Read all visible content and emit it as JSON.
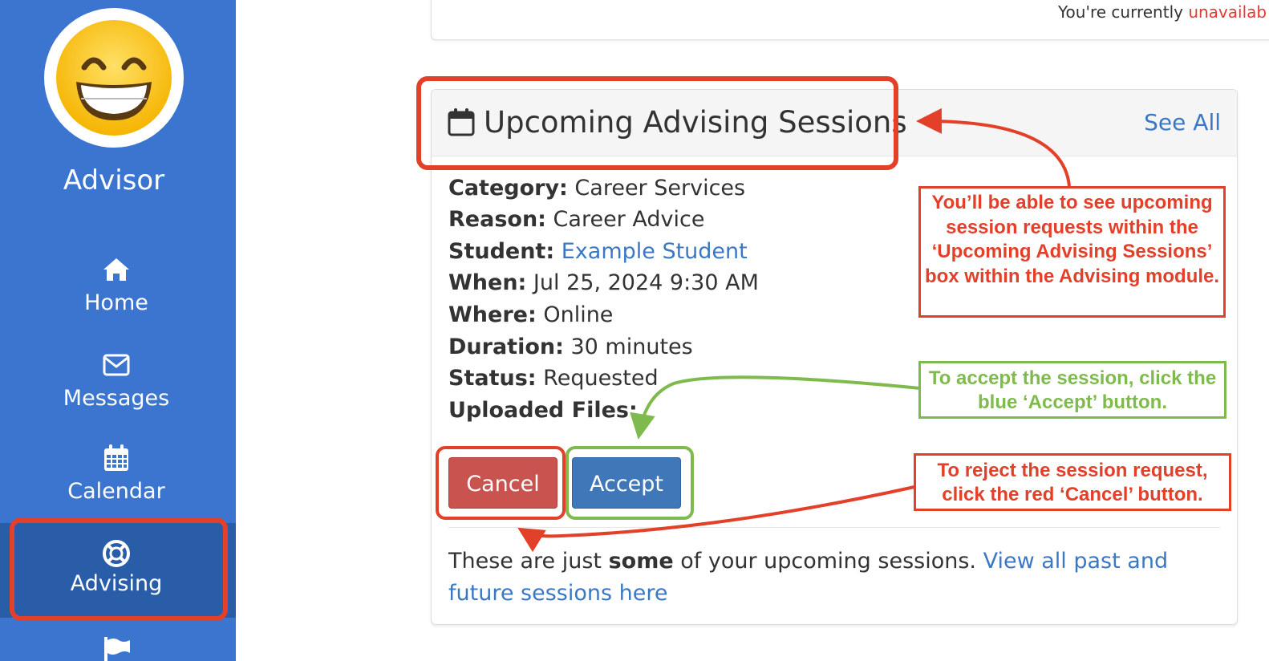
{
  "sidebar": {
    "role_label": "Advisor",
    "items": [
      {
        "label": "Home",
        "icon": "home-icon"
      },
      {
        "label": "Messages",
        "icon": "envelope-icon"
      },
      {
        "label": "Calendar",
        "icon": "calendar-icon"
      },
      {
        "label": "Advising",
        "icon": "life-ring-icon",
        "active": true
      }
    ]
  },
  "status": {
    "prefix": "You're currently ",
    "state": "unavailab"
  },
  "card": {
    "title": "Upcoming Advising Sessions",
    "see_all": "See All",
    "fields": {
      "category_label": "Category:",
      "category_value": " Career Services",
      "reason_label": "Reason:",
      "reason_value": " Career Advice",
      "student_label": "Student:",
      "student_value": "Example Student",
      "when_label": "When:",
      "when_value": " Jul 25, 2024 9:30 AM",
      "where_label": "Where:",
      "where_value": " Online",
      "duration_label": "Duration:",
      "duration_value": " 30 minutes",
      "status_label": "Status:",
      "status_value": " Requested",
      "files_label": "Uploaded Files:"
    },
    "buttons": {
      "cancel": "Cancel",
      "accept": "Accept"
    },
    "footer": {
      "before": "These are just ",
      "bold": "some",
      "after": " of your upcoming sessions. ",
      "link": "View all past and future sessions here"
    }
  },
  "annotations": {
    "header_note": "You’ll be able to see upcoming session requests within the ‘Upcoming Advising Sessions’ box within the Advising module.",
    "accept_note": "To accept the session, click the blue ‘Accept’ button.",
    "cancel_note": "To reject the session request, click the red ‘Cancel’ button."
  },
  "colors": {
    "sidebar": "#3c75cf",
    "sidebar_active": "#2a5da8",
    "annotation_red": "#e3402a",
    "annotation_green": "#7fba4e",
    "link": "#3a78c4",
    "cancel_button": "#c9534f",
    "accept_button": "#3f77b9"
  }
}
